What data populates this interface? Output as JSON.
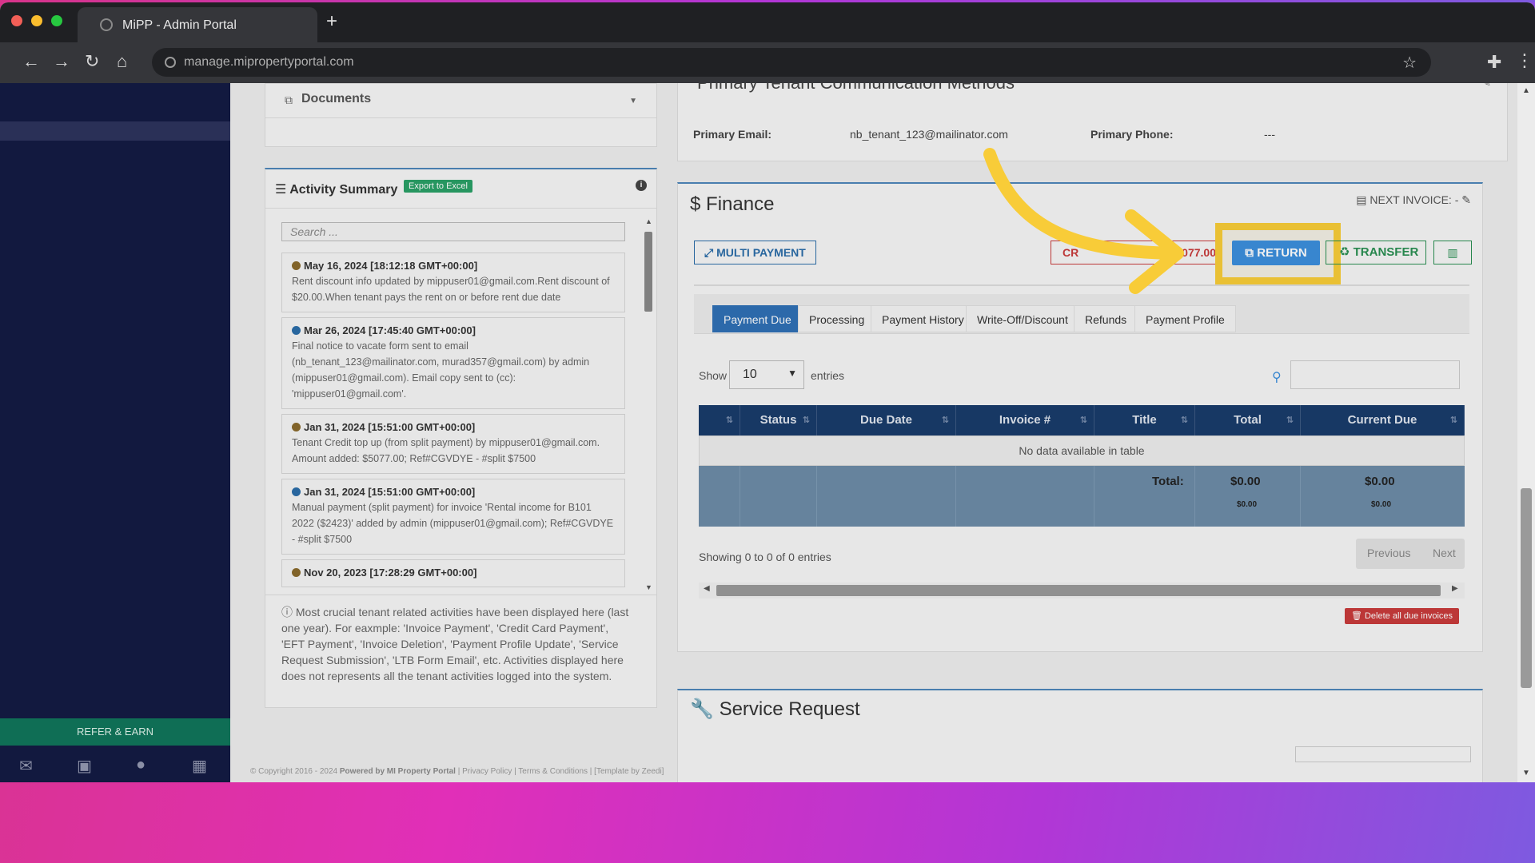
{
  "browser": {
    "tab_title": "MiPP - Admin Portal",
    "url": "manage.mipropertyportal.com"
  },
  "sidebar": {
    "refer_label": "REFER & EARN"
  },
  "documents": {
    "title": "Documents"
  },
  "activity": {
    "title": "Activity Summary",
    "export_label": "Export to Excel",
    "search_placeholder": "Search ...",
    "items": [
      {
        "date": "May 16, 2024 [18:12:18 GMT+00:00]",
        "dot_color": "#8a6a2c",
        "text": "Rent discount info updated by mippuser01@gmail.com.Rent discount of $20.00.When tenant pays the rent on or before rent due date"
      },
      {
        "date": "Mar 26, 2024 [17:45:40 GMT+00:00]",
        "dot_color": "#2b6da8",
        "text": "Final notice to vacate form sent to email (nb_tenant_123@mailinator.com, murad357@gmail.com) by admin (mippuser01@gmail.com). Email copy sent to (cc): 'mippuser01@gmail.com'."
      },
      {
        "date": "Jan 31, 2024 [15:51:00 GMT+00:00]",
        "dot_color": "#8a6a2c",
        "text": "Tenant Credit top up (from split payment) by mippuser01@gmail.com. Amount added: $5077.00; Ref#CGVDYE - #split $7500"
      },
      {
        "date": "Jan 31, 2024 [15:51:00 GMT+00:00]",
        "dot_color": "#2b6da8",
        "text": "Manual payment (split payment) for invoice 'Rental income for B101 2022 ($2423)' added by admin (mippuser01@gmail.com); Ref#CGVDYE - #split $7500"
      },
      {
        "date": "Nov 20, 2023 [17:28:29 GMT+00:00]",
        "dot_color": "#8a6a2c",
        "text": ""
      }
    ],
    "note": "Most crucial tenant related activities have been displayed here (last one year). For eaxmple: 'Invoice Payment', 'Credit Card Payment', 'EFT Payment', 'Invoice Deletion', 'Payment Profile Update', 'Service Request Submission', 'LTB Form Email', etc. Activities displayed here does not represents all the tenant activities logged into the system."
  },
  "communication": {
    "title": "Primary Tenant Communication Methods",
    "email_label": "Primary Email:",
    "email_value": "nb_tenant_123@mailinator.com",
    "phone_label": "Primary Phone:",
    "phone_value": "---"
  },
  "finance": {
    "title": "Finance",
    "next_invoice": "NEXT INVOICE: -",
    "multi_payment": "MULTI PAYMENT",
    "credit_label": "CR",
    "credit_amount": "077.00",
    "return_label": "RETURN",
    "transfer_label": "TRANSFER",
    "tabs": [
      "Payment Due",
      "Processing",
      "Payment History",
      "Write-Off/Discount",
      "Refunds",
      "Payment Profile"
    ],
    "active_tab": "Payment Due",
    "show_label": "Show",
    "entries_label": "entries",
    "page_size": "10",
    "columns": [
      "",
      "Status",
      "Due Date",
      "Invoice #",
      "Title",
      "Total",
      "Current Due"
    ],
    "no_data": "No data available in table",
    "total_label": "Total:",
    "total_value": "$0.00",
    "total_sub": "$0.00",
    "current_due_value": "$0.00",
    "current_due_sub": "$0.00",
    "showing": "Showing 0 to 0 of 0 entries",
    "previous": "Previous",
    "next": "Next",
    "delete_all": "Delete all due invoices"
  },
  "service_request": {
    "title": "Service Request"
  },
  "footer": {
    "copyright": "© Copyright 2016 - 2024",
    "powered": "Powered by MI Property Portal",
    "links": "| Privacy Policy | Terms & Conditions |",
    "template": "[Template by Zeedi]"
  },
  "colors": {
    "highlight": "#f8cc38",
    "return_button": "#3c8fdc",
    "sidebar": "#12193f",
    "table_header": "#193c6b"
  }
}
